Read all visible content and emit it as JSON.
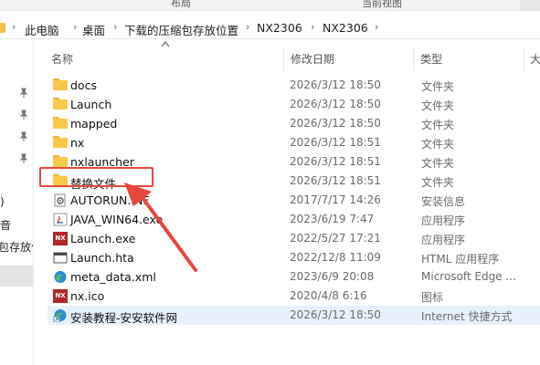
{
  "ribbon": {
    "left_label": "布局",
    "right_label": "当前视图"
  },
  "breadcrumb": [
    "此电脑",
    "桌面",
    "下载的压缩包存放位置",
    "NX2306",
    "NX2306"
  ],
  "nav_fragments": [
    ")",
    "音",
    "包存放位"
  ],
  "columns": {
    "name": "名称",
    "date": "修改日期",
    "type": "类型",
    "size": "大"
  },
  "files": [
    {
      "name": "docs",
      "date": "2026/3/12 18:50",
      "type": "文件夹",
      "icon": "folder-icon"
    },
    {
      "name": "Launch",
      "date": "2026/3/12 18:50",
      "type": "文件夹",
      "icon": "folder-icon"
    },
    {
      "name": "mapped",
      "date": "2026/3/12 18:50",
      "type": "文件夹",
      "icon": "folder-icon"
    },
    {
      "name": "nx",
      "date": "2026/3/12 18:51",
      "type": "文件夹",
      "icon": "folder-icon"
    },
    {
      "name": "nxlauncher",
      "date": "2026/3/12 18:51",
      "type": "文件夹",
      "icon": "folder-icon"
    },
    {
      "name": "替换文件",
      "date": "2026/3/12 18:51",
      "type": "文件夹",
      "icon": "folder-icon"
    },
    {
      "name": "AUTORUN.INF",
      "date": "2017/7/17 14:26",
      "type": "安装信息",
      "icon": "settings-file-icon"
    },
    {
      "name": "JAVA_WIN64.exe",
      "date": "2023/6/19 7:47",
      "type": "应用程序",
      "icon": "java-icon"
    },
    {
      "name": "Launch.exe",
      "date": "2022/5/27 17:21",
      "type": "应用程序",
      "icon": "nx-icon"
    },
    {
      "name": "Launch.hta",
      "date": "2022/12/8 11:09",
      "type": "HTML 应用程序",
      "icon": "hta-window-icon"
    },
    {
      "name": "meta_data.xml",
      "date": "2023/6/9 20:08",
      "type": "Microsoft Edge ...",
      "icon": "edge-icon"
    },
    {
      "name": "nx.ico",
      "date": "2020/4/8 6:16",
      "type": "图标",
      "icon": "nx-icon"
    },
    {
      "name": "安装教程-安安软件网",
      "date": "2026/3/12 18:50",
      "type": "Internet 快捷方式",
      "icon": "internet-shortcut-icon"
    }
  ],
  "nx_icon_text": "NX",
  "colors": {
    "annotation": "#e8483f",
    "folder": "#f6c94b",
    "highlight_row": "#e7f1fb",
    "nx_brand": "#b4262b"
  }
}
